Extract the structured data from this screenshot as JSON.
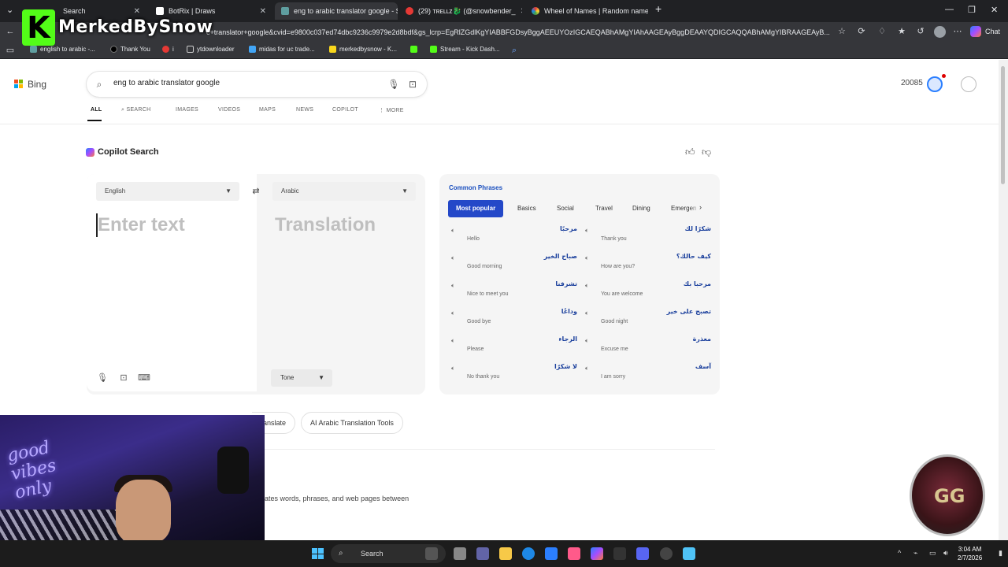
{
  "browser": {
    "tabs": [
      {
        "title": "Search",
        "active": false
      },
      {
        "title": "BotRix | Draws",
        "active": false
      },
      {
        "title": "eng to arabic translator google - S",
        "active": true
      },
      {
        "title": "(29) ᴛʀᴇʟʟᴢ🐉 (@snowbender_",
        "active": false
      },
      {
        "title": "Wheel of Names | Random name",
        "active": false
      }
    ],
    "url": "c+translator+google&cvid=e9800c037ed74dbc9236c9979e2d8bdf&gs_lcrp=EgRlZGdlKgYIABBFGDsyBggAEEUYOzIGCAEQABhAMgYIAhAAGEAyBggDEAAYQDIGCAQQABhAMgYIBRAAGEAyB...",
    "chat_label": "Chat",
    "bookmarks": [
      "english to arabic -...",
      "Thank You",
      "i",
      "ytdownloader",
      "midas for uc trade...",
      "merkedbysnow - K...",
      "",
      "Stream - Kick Dash..."
    ]
  },
  "stream_overlay": {
    "channel_name": "MerkedBySnow"
  },
  "bing": {
    "logo": "Bing",
    "query": "eng to arabic translator google",
    "rewards_points": "20085",
    "nav": [
      "ALL",
      "SEARCH",
      "IMAGES",
      "VIDEOS",
      "MAPS",
      "NEWS",
      "COPILOT",
      "MORE"
    ],
    "copilot_title": "Copilot Search"
  },
  "translator": {
    "source_lang": "English",
    "target_lang": "Arabic",
    "input_placeholder": "Enter text",
    "output_placeholder": "Translation",
    "tone_label": "Tone"
  },
  "common_phrases": {
    "title": "Common Phrases",
    "tabs": [
      "Most popular",
      "Basics",
      "Social",
      "Travel",
      "Dining",
      "Emergen"
    ],
    "phrases": [
      {
        "ar": "مرحبًا",
        "en": "Hello"
      },
      {
        "ar": "شكرًا لك",
        "en": "Thank you"
      },
      {
        "ar": "صباح الخير",
        "en": "Good morning"
      },
      {
        "ar": "كيف حالك؟",
        "en": "How are you?"
      },
      {
        "ar": "تشرفنا",
        "en": "Nice to meet you"
      },
      {
        "ar": "مرحبا بك",
        "en": "You are welcome"
      },
      {
        "ar": "وداعًا",
        "en": "Good bye"
      },
      {
        "ar": "تصبح على خير",
        "en": "Good night"
      },
      {
        "ar": "الرجاء",
        "en": "Please"
      },
      {
        "ar": "معذرة",
        "en": "Excuse me"
      },
      {
        "ar": "لا شكرًا",
        "en": "No thank you"
      },
      {
        "ar": "آسف",
        "en": "I am sorry"
      }
    ]
  },
  "chips": [
    "ranslate",
    "AI Arabic Translation Tools"
  ],
  "description_fragment": "ates words, phrases, and web pages between",
  "taskbar": {
    "search_label": "Search",
    "time": "3:04 AM",
    "date": "2/7/2026"
  },
  "colors": {
    "accent_blue": "#2448c8",
    "kick_green": "#53fc18",
    "arabic_text": "#1a3f9c"
  }
}
